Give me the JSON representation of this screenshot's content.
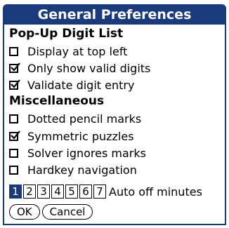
{
  "dialog": {
    "title": "General Preferences"
  },
  "popup_digit_list": {
    "heading": "Pop-Up Digit List",
    "options": [
      {
        "label": "Display at top left",
        "checked": false
      },
      {
        "label": "Only show valid digits",
        "checked": true
      },
      {
        "label": "Validate digit entry",
        "checked": true
      }
    ]
  },
  "miscellaneous": {
    "heading": "Miscellaneous",
    "options": [
      {
        "label": "Dotted pencil marks",
        "checked": false
      },
      {
        "label": "Symmetric puzzles",
        "checked": true
      },
      {
        "label": "Solver ignores marks",
        "checked": false
      },
      {
        "label": "Hardkey navigation",
        "checked": false
      }
    ]
  },
  "auto_off": {
    "values": [
      "1",
      "2",
      "3",
      "4",
      "5",
      "6",
      "7"
    ],
    "selected": "1",
    "label": "Auto off minutes"
  },
  "buttons": {
    "ok": "OK",
    "cancel": "Cancel"
  },
  "colors": {
    "accent": "#1a3a7c"
  }
}
